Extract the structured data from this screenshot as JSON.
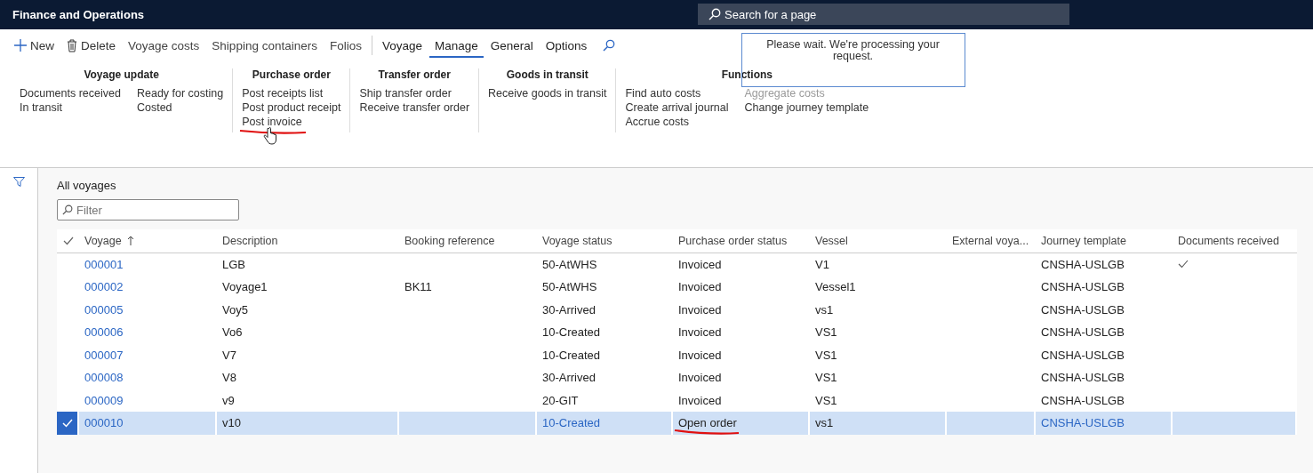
{
  "app_title": "Finance and Operations",
  "search": {
    "placeholder": "Search for a page"
  },
  "actions": [
    {
      "label": "New",
      "kind": "new"
    },
    {
      "label": "Delete",
      "kind": "delete"
    },
    {
      "label": "Voyage costs",
      "kind": "plain"
    },
    {
      "label": "Shipping containers",
      "kind": "plain"
    },
    {
      "label": "Folios",
      "kind": "plain"
    }
  ],
  "tabs": [
    {
      "label": "Voyage",
      "selected": false
    },
    {
      "label": "Manage",
      "selected": true
    },
    {
      "label": "General",
      "selected": false
    },
    {
      "label": "Options",
      "selected": false
    }
  ],
  "ribbon_groups": [
    {
      "title": "Voyage update",
      "columns": [
        [
          {
            "label": "Documents received",
            "disabled": false
          },
          {
            "label": "In transit",
            "disabled": false
          }
        ],
        [
          {
            "label": "Ready for costing",
            "disabled": false
          },
          {
            "label": "Costed",
            "disabled": false
          }
        ]
      ]
    },
    {
      "title": "Purchase order",
      "columns": [
        [
          {
            "label": "Post receipts list",
            "disabled": false
          },
          {
            "label": "Post product receipt",
            "disabled": false
          },
          {
            "label": "Post invoice",
            "disabled": false,
            "annotated": true
          }
        ]
      ]
    },
    {
      "title": "Transfer order",
      "columns": [
        [
          {
            "label": "Ship transfer order",
            "disabled": false
          },
          {
            "label": "Receive transfer order",
            "disabled": false
          }
        ]
      ]
    },
    {
      "title": "Goods in transit",
      "columns": [
        [
          {
            "label": "Receive goods in transit",
            "disabled": false
          }
        ]
      ]
    },
    {
      "title": "Functions",
      "columns": [
        [
          {
            "label": "Find auto costs",
            "disabled": false
          },
          {
            "label": "Create arrival journal",
            "disabled": false
          },
          {
            "label": "Accrue costs",
            "disabled": false
          }
        ],
        [
          {
            "label": "Aggregate costs",
            "disabled": true
          },
          {
            "label": "Change journey template",
            "disabled": false
          }
        ]
      ]
    }
  ],
  "dialog": {
    "message": "Please wait. We're processing your request."
  },
  "list_title": "All voyages",
  "filter": {
    "placeholder": "Filter"
  },
  "table": {
    "columns": [
      "Voyage",
      "Description",
      "Booking reference",
      "Voyage status",
      "Purchase order status",
      "Vessel",
      "External voya...",
      "Journey template",
      "Documents received"
    ],
    "rows": [
      {
        "voyage": "000001",
        "description": "LGB",
        "booking": "",
        "voyage_status": "50-AtWHS",
        "po_status": "Invoiced",
        "vessel": "V1",
        "journey": "CNSHA-USLGB",
        "documents_received": true,
        "selected": false,
        "po_annotated": false
      },
      {
        "voyage": "000002",
        "description": "Voyage1",
        "booking": "BK11",
        "voyage_status": "50-AtWHS",
        "po_status": "Invoiced",
        "vessel": "Vessel1",
        "journey": "CNSHA-USLGB",
        "documents_received": false,
        "selected": false,
        "po_annotated": false
      },
      {
        "voyage": "000005",
        "description": "Voy5",
        "booking": "",
        "voyage_status": "30-Arrived",
        "po_status": "Invoiced",
        "vessel": "vs1",
        "journey": "CNSHA-USLGB",
        "documents_received": false,
        "selected": false,
        "po_annotated": false
      },
      {
        "voyage": "000006",
        "description": "Vo6",
        "booking": "",
        "voyage_status": "10-Created",
        "po_status": "Invoiced",
        "vessel": "VS1",
        "journey": "CNSHA-USLGB",
        "documents_received": false,
        "selected": false,
        "po_annotated": false
      },
      {
        "voyage": "000007",
        "description": "V7",
        "booking": "",
        "voyage_status": "10-Created",
        "po_status": "Invoiced",
        "vessel": "VS1",
        "journey": "CNSHA-USLGB",
        "documents_received": false,
        "selected": false,
        "po_annotated": false
      },
      {
        "voyage": "000008",
        "description": "V8",
        "booking": "",
        "voyage_status": "30-Arrived",
        "po_status": "Invoiced",
        "vessel": "VS1",
        "journey": "CNSHA-USLGB",
        "documents_received": false,
        "selected": false,
        "po_annotated": false
      },
      {
        "voyage": "000009",
        "description": "v9",
        "booking": "",
        "voyage_status": "20-GIT",
        "po_status": "Invoiced",
        "vessel": "VS1",
        "journey": "CNSHA-USLGB",
        "documents_received": false,
        "selected": false,
        "po_annotated": false
      },
      {
        "voyage": "000010",
        "description": "v10",
        "booking": "",
        "voyage_status": "10-Created",
        "po_status": "Open order",
        "vessel": "vs1",
        "journey": "CNSHA-USLGB",
        "documents_received": false,
        "selected": true,
        "po_annotated": true
      }
    ]
  }
}
